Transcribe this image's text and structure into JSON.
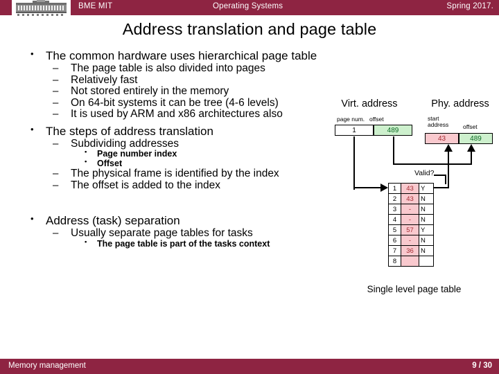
{
  "header": {
    "logo_alt": "bme-building-logo",
    "course": "BME MIT",
    "subject": "Operating Systems",
    "term": "Spring 2017."
  },
  "title": "Address translation and page table",
  "content": {
    "section1": {
      "heading": "The common hardware uses hierarchical page table",
      "items": [
        "The page table is also divided into pages",
        "Relatively fast",
        "Not stored entirely in the memory",
        "On 64-bit systems it can be tree (4-6 levels)",
        "It is used by ARM and x86 architectures also"
      ]
    },
    "section2": {
      "heading": "The steps of address translation",
      "sub1": "Subdividing addresses",
      "sub1_items": [
        "Page number index",
        "Offset"
      ],
      "sub2": "The physical frame is identified by the index",
      "sub3": "The offset is added to the index"
    },
    "section3": {
      "heading": "Address (task) separation",
      "sub1": "Usually separate page tables for tasks",
      "sub1_items": [
        "The page table is part of the tasks context"
      ]
    }
  },
  "diagram": {
    "virt_address_label": "Virt. address",
    "phy_address_label": "Phy. address",
    "virt_field_labels": {
      "page_num": "page num.",
      "offset": "offset"
    },
    "phy_field_labels": {
      "start_address": "start\naddress",
      "offset": "offset"
    },
    "virt_address": {
      "page_num": "1",
      "offset": "489"
    },
    "phy_address": {
      "start_address": "43",
      "offset": "489"
    },
    "valid_header": "Valid?",
    "caption": "Single level page table",
    "page_table": {
      "rows": [
        {
          "index": "1",
          "frame": "43",
          "valid": "Y"
        },
        {
          "index": "2",
          "frame": "43",
          "valid": "N"
        },
        {
          "index": "3",
          "frame": "-",
          "valid": "N"
        },
        {
          "index": "4",
          "frame": "-",
          "valid": "N"
        },
        {
          "index": "5",
          "frame": "57",
          "valid": "Y"
        },
        {
          "index": "6",
          "frame": "-",
          "valid": "N"
        },
        {
          "index": "7",
          "frame": "36",
          "valid": "N"
        },
        {
          "index": "8",
          "frame": "",
          "valid": ""
        }
      ]
    },
    "colors": {
      "pink_fill": "#f9c9ce",
      "pink_text": "#a32b32",
      "green_fill": "#cdf0cd",
      "green_text": "#0b6b23",
      "line": "#000000"
    }
  },
  "footer": {
    "topic": "Memory management",
    "page": "9 / 30"
  },
  "theme": {
    "accent": "#8e2442"
  }
}
